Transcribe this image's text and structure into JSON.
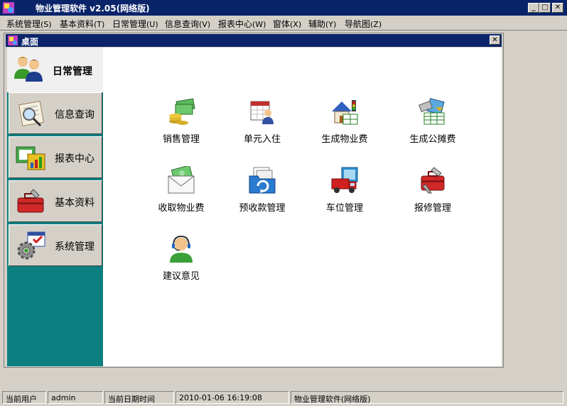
{
  "window": {
    "title": "物业管理软件 v2.05(网络版)",
    "min_glyph": "_",
    "max_glyph": "□",
    "close_glyph": "✕"
  },
  "menu": [
    {
      "label": "系统管理",
      "hotkey": "(S)"
    },
    {
      "label": "基本资料",
      "hotkey": "(T)"
    },
    {
      "label": "日常管理",
      "hotkey": "(U)"
    },
    {
      "label": "信息查询",
      "hotkey": "(V)"
    },
    {
      "label": "报表中心",
      "hotkey": "(W)"
    },
    {
      "label": "窗体",
      "hotkey": "(X)"
    },
    {
      "label": "辅助",
      "hotkey": "(Y)"
    },
    {
      "label": "导航图",
      "hotkey": "(Z)"
    }
  ],
  "desktop_window": {
    "title": "桌面",
    "close_glyph": "✕"
  },
  "nav": [
    {
      "label": "日常管理",
      "icon": "people-icon",
      "active": true
    },
    {
      "label": "信息查询",
      "icon": "magnifier-document-icon",
      "active": false
    },
    {
      "label": "报表中心",
      "icon": "report-chart-icon",
      "active": false
    },
    {
      "label": "基本资料",
      "icon": "toolbox-icon",
      "active": false
    },
    {
      "label": "系统管理",
      "icon": "settings-gear-icon",
      "active": false
    }
  ],
  "tiles": [
    {
      "label": "销售管理",
      "icon": "money-coins-icon"
    },
    {
      "label": "单元入住",
      "icon": "calendar-person-icon"
    },
    {
      "label": "生成物业费",
      "icon": "house-traffic-light-icon"
    },
    {
      "label": "生成公摊费",
      "icon": "calculator-grid-icon"
    },
    {
      "label": "收取物业费",
      "icon": "envelope-money-icon"
    },
    {
      "label": "预收款管理",
      "icon": "folder-refresh-icon"
    },
    {
      "label": "车位管理",
      "icon": "truck-icon"
    },
    {
      "label": "报修管理",
      "icon": "toolbox-wrench-icon"
    },
    {
      "label": "建议意见",
      "icon": "headset-operator-icon"
    }
  ],
  "status": {
    "user_label": "当前用户",
    "user_value": "admin",
    "datetime_label": "当前日期时间",
    "datetime_value": "2010-01-06 16:19:08",
    "product": "物业管理软件(网络版)"
  },
  "colors": {
    "title_bar": "#0a246a",
    "nav_background": "#0c8080",
    "chrome": "#d4d0c8"
  }
}
